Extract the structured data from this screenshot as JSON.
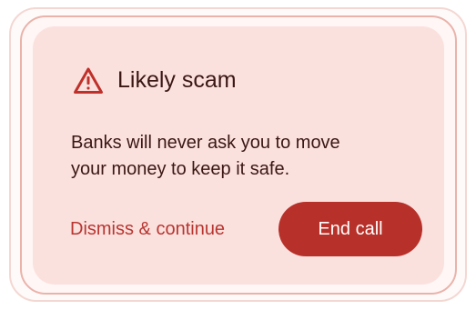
{
  "alert": {
    "icon": "warning-triangle-icon",
    "title": "Likely scam",
    "message_line1": "Banks will never ask you to move",
    "message_line2": "your money to keep it safe.",
    "dismiss_label": "Dismiss & continue",
    "end_call_label": "End call"
  },
  "colors": {
    "card_background": "#fbe1de",
    "accent": "#b7312a",
    "dismiss_text": "#b83530",
    "text": "#3a1713"
  }
}
